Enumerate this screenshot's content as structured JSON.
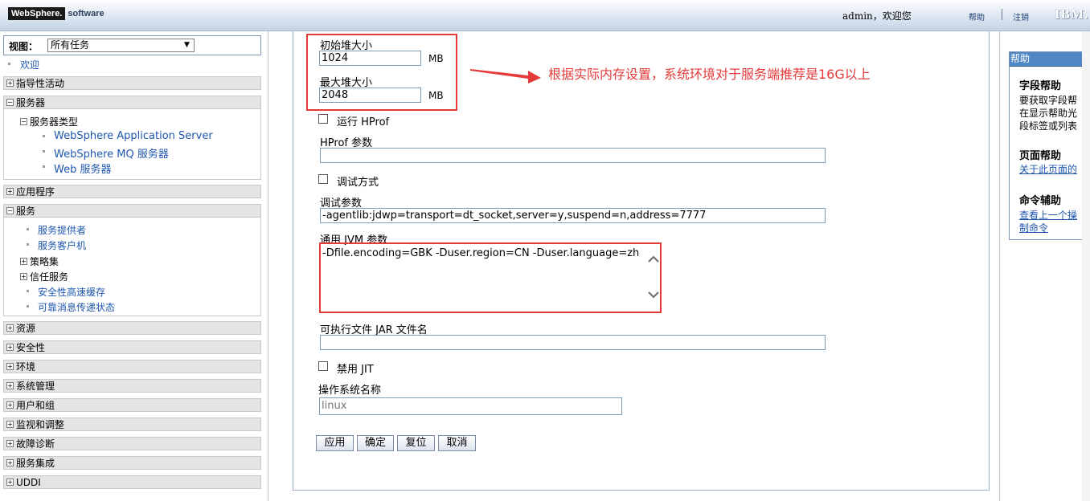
{
  "header": {
    "logo_brand": "WebSphere.",
    "logo_suffix": "software",
    "welcome": "admin，欢迎您",
    "help": "帮助",
    "separator": "|",
    "logout": "注销",
    "ibm": "IBM."
  },
  "nav": {
    "view_label": "视图：",
    "view_value": "所有任务",
    "welcome": "欢迎",
    "sections": {
      "guided": "指导性活动",
      "servers": "服务器",
      "apps": "应用程序",
      "services": "服务",
      "resources": "资源",
      "security": "安全性",
      "environment": "环境",
      "sysadmin": "系统管理",
      "users": "用户和组",
      "monitor": "监视和调整",
      "troubleshoot": "故障诊断",
      "integration": "服务集成",
      "uddi": "UDDI"
    },
    "servers_children": {
      "server_types": "服务器类型",
      "was": "WebSphere Application Server",
      "mq": "WebSphere MQ 服务器",
      "web": "Web 服务器"
    },
    "services_children": {
      "providers": "服务提供者",
      "clients": "服务客户机",
      "policy_sets": "策略集",
      "trust": "信任服务",
      "security_cache": "安全性高速缓存",
      "reliable_msg": "可靠消息传递状态"
    }
  },
  "form": {
    "initial_heap_label": "初始堆大小",
    "initial_heap_value": "1024",
    "initial_heap_unit": "MB",
    "max_heap_label": "最大堆大小",
    "max_heap_value": "2048",
    "max_heap_unit": "MB",
    "run_hprof_label": "运行 HProf",
    "hprof_args_label": "HProf 参数",
    "hprof_args_value": "",
    "debug_mode_label": "调试方式",
    "debug_args_label": "调试参数",
    "debug_args_value": "-agentlib:jdwp=transport=dt_socket,server=y,suspend=n,address=7777",
    "jvm_args_label": "通用 JVM 参数",
    "jvm_args_value": "-Dfile.encoding=GBK -Duser.region=CN -Duser.language=zh",
    "jar_label": "可执行文件 JAR 文件名",
    "jar_value": "",
    "disable_jit_label": "禁用 JIT",
    "os_name_label": "操作系统名称",
    "os_name_placeholder": "linux",
    "buttons": {
      "apply": "应用",
      "ok": "确定",
      "reset": "复位",
      "cancel": "取消"
    }
  },
  "annotation": {
    "text": "根据实际内存设置，系统环境对于服务端推荐是16G以上",
    "color": "#e53a3a"
  },
  "help_panel": {
    "title": "帮助",
    "field_help_title": "字段帮助",
    "field_help_line1": "要获取字段帮",
    "field_help_line2": "在显示帮助光",
    "field_help_line3": "段标签或列表",
    "page_help_title": "页面帮助",
    "page_help_link": "关于此页面的",
    "command_title": "命令辅助",
    "command_link1": "查看上一个操",
    "command_link2": "制命令"
  }
}
